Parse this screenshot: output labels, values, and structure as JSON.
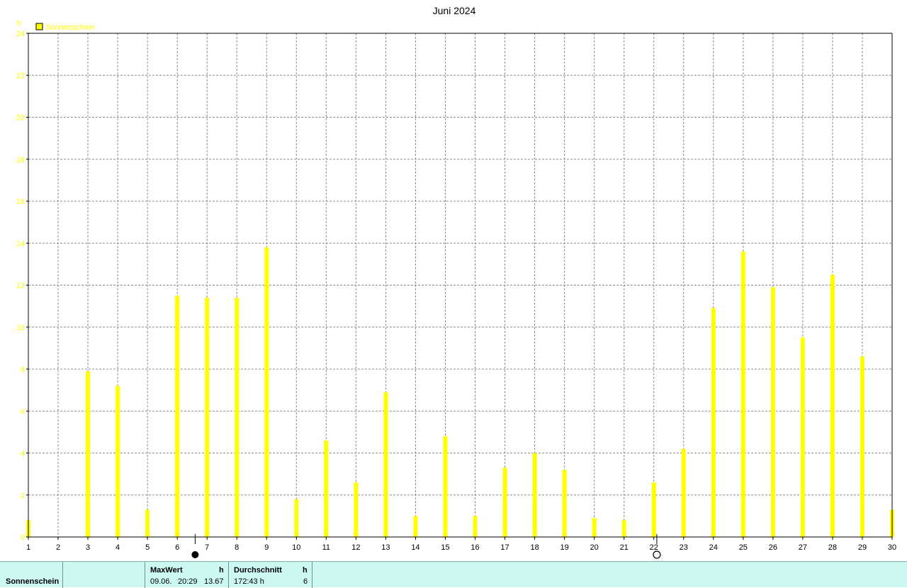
{
  "chart_data": {
    "type": "bar",
    "title": "Juni 2024",
    "ylabel": "h",
    "ylim": [
      0,
      24
    ],
    "yticks": [
      0,
      2,
      4,
      6,
      8,
      10,
      12,
      14,
      16,
      18,
      20,
      22,
      24
    ],
    "grid": true,
    "legend_position": "top-left",
    "categories": [
      "1",
      "2",
      "3",
      "4",
      "5",
      "6",
      "7",
      "8",
      "9",
      "10",
      "11",
      "12",
      "13",
      "14",
      "15",
      "16",
      "17",
      "18",
      "19",
      "20",
      "21",
      "22",
      "23",
      "24",
      "25",
      "26",
      "27",
      "28",
      "29",
      "30"
    ],
    "series": [
      {
        "name": "Sonnenschein",
        "color": "#ffff00",
        "values": [
          0.8,
          0,
          7.9,
          7.2,
          1.3,
          11.5,
          11.4,
          11.4,
          13.8,
          1.8,
          4.6,
          2.6,
          6.9,
          1.0,
          4.8,
          1.0,
          3.3,
          4.0,
          3.2,
          0.9,
          0.8,
          2.6,
          4.2,
          10.9,
          13.6,
          11.9,
          9.5,
          12.5,
          8.6,
          1.3
        ]
      }
    ],
    "moon_phases": [
      {
        "phase": "new-moon",
        "x": 6.6
      },
      {
        "phase": "full-moon",
        "x": 22.1
      }
    ]
  },
  "table": {
    "row_label": "Sonnenschein",
    "max_header": "MaxWert",
    "max_unit": "h",
    "max_date": "09.06.",
    "max_time": "20:29",
    "max_value": "13.67",
    "avg_header": "Durchschnitt",
    "avg_unit": "h",
    "avg_total": "172:43 h",
    "avg_value": "6"
  },
  "colors": {
    "bar": "#ffff00",
    "axis": "#000000",
    "grid": "#808080",
    "table_bg": "#ccf8f4"
  }
}
